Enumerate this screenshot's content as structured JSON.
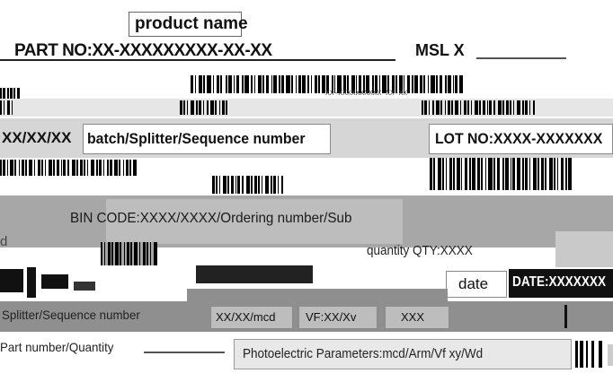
{
  "label": {
    "product_name": "product name",
    "part_no": "PART NO:XX-XXXXXXXXX-XX-XX",
    "msl": "MSL X",
    "small_code_1": "XX-XXXXXXXXXX-XX-XX",
    "date_code": "XX/XX/XX",
    "batch": "batch/Splitter/Sequence number",
    "lot_no": "LOT NO:XXXX-XXXXXXX",
    "bin_code": "BIN CODE:XXXX/XXXX/Ordering number/Sub",
    "quantity": "quantity QTY:XXXX",
    "date_label": "date",
    "date_value": "DATE:XXXXXXX",
    "bottom_sequence": "Splitter/Sequence number",
    "bottom_codes": [
      "XX/XX/mcd",
      "VF:XX/Xv",
      "XXX"
    ],
    "part_number_quantity": "Part number/Quantity",
    "photoelectric": "Photoelectric Parameters:mcd/Arm/Vf xy/Wd"
  }
}
